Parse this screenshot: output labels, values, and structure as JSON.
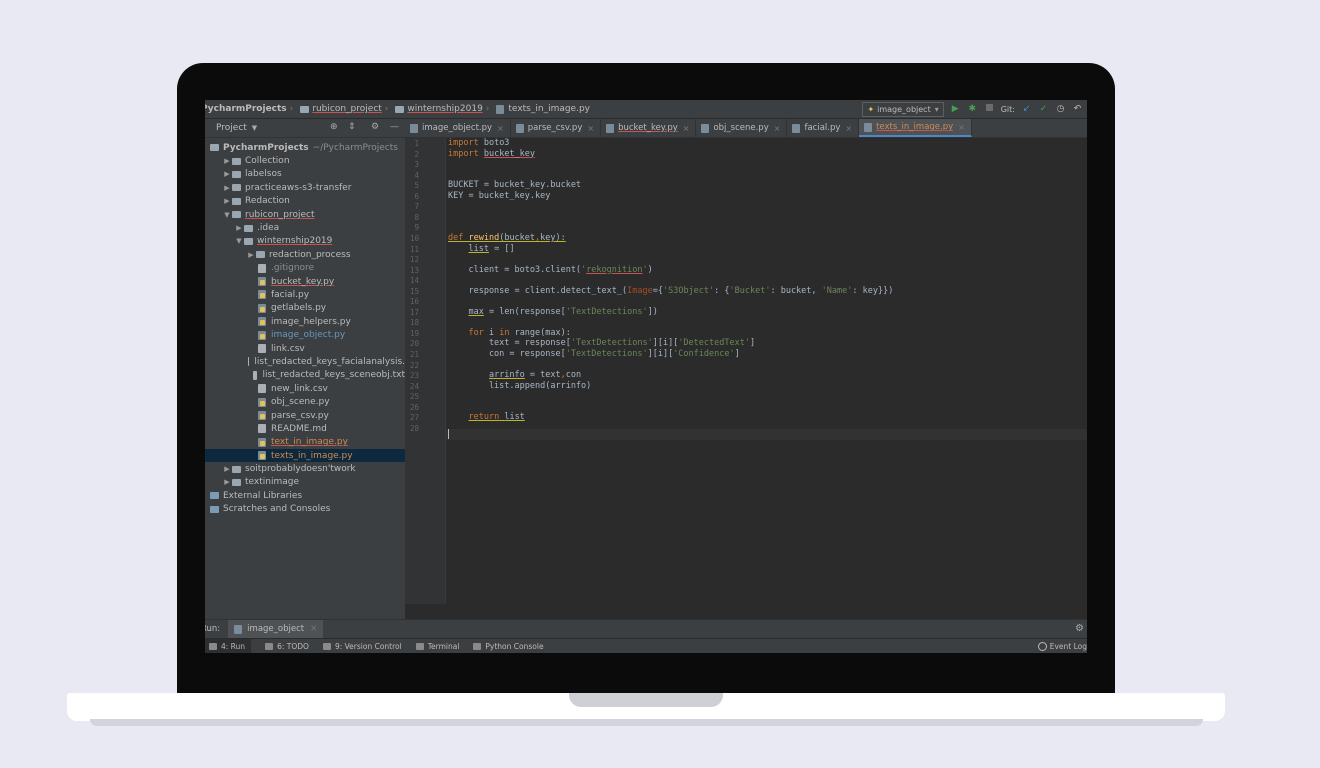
{
  "breadcrumbs": [
    "PycharmProjects",
    "rubicon_project",
    "winternship2019",
    "texts_in_image.py"
  ],
  "run_config": {
    "label": "image_object"
  },
  "git_label": "Git:",
  "project_pane": {
    "title": "Project",
    "root": {
      "name": "PycharmProjects",
      "path": "~/PycharmProjects"
    },
    "items": [
      {
        "label": "Collection",
        "type": "folder",
        "depth": 1,
        "arrow": "▶"
      },
      {
        "label": "labelsos",
        "type": "folder",
        "depth": 1,
        "arrow": "▶"
      },
      {
        "label": "practiceaws-s3-transfer",
        "type": "folder",
        "depth": 1,
        "arrow": "▶"
      },
      {
        "label": "Redaction",
        "type": "folder",
        "depth": 1,
        "arrow": "▶"
      },
      {
        "label": "rubicon_project",
        "type": "folder",
        "depth": 1,
        "arrow": "▼",
        "error": true
      },
      {
        "label": ".idea",
        "type": "folder",
        "depth": 2,
        "arrow": "▶"
      },
      {
        "label": "winternship2019",
        "type": "folder",
        "depth": 2,
        "arrow": "▼",
        "error": true
      },
      {
        "label": "redaction_process",
        "type": "folder",
        "depth": 3,
        "arrow": "▶"
      },
      {
        "label": ".gitignore",
        "type": "text",
        "depth": 3,
        "color": "grey"
      },
      {
        "label": "bucket_key.py",
        "type": "py",
        "depth": 3,
        "error": true
      },
      {
        "label": "facial.py",
        "type": "py",
        "depth": 3
      },
      {
        "label": "getlabels.py",
        "type": "py",
        "depth": 3
      },
      {
        "label": "image_helpers.py",
        "type": "py",
        "depth": 3
      },
      {
        "label": "image_object.py",
        "type": "py",
        "depth": 3,
        "color": "blue"
      },
      {
        "label": "link.csv",
        "type": "text",
        "depth": 3
      },
      {
        "label": "list_redacted_keys_facialanalysis.",
        "type": "text",
        "depth": 3
      },
      {
        "label": "list_redacted_keys_sceneobj.txt",
        "type": "text",
        "depth": 3
      },
      {
        "label": "new_link.csv",
        "type": "text",
        "depth": 3
      },
      {
        "label": "obj_scene.py",
        "type": "py",
        "depth": 3
      },
      {
        "label": "parse_csv.py",
        "type": "py",
        "depth": 3
      },
      {
        "label": "README.md",
        "type": "text",
        "depth": 3
      },
      {
        "label": "text_in_image.py",
        "type": "py",
        "depth": 3,
        "color": "orange",
        "error": true
      },
      {
        "label": "texts_in_image.py",
        "type": "py",
        "depth": 3,
        "color": "orange",
        "selected": true
      },
      {
        "label": "soitprobablydoesn'twork",
        "type": "folder",
        "depth": 1,
        "arrow": "▶"
      },
      {
        "label": "textinimage",
        "type": "folder",
        "depth": 1,
        "arrow": "▶"
      },
      {
        "label": "External Libraries",
        "type": "lib",
        "depth": 0
      },
      {
        "label": "Scratches and Consoles",
        "type": "lib",
        "depth": 0
      }
    ]
  },
  "tabs": [
    {
      "label": "image_object.py"
    },
    {
      "label": "parse_csv.py"
    },
    {
      "label": "bucket_key.py",
      "error": true
    },
    {
      "label": "obj_scene.py"
    },
    {
      "label": "facial.py"
    },
    {
      "label": "texts_in_image.py",
      "active": true
    }
  ],
  "code": {
    "line_numbers": [
      "1",
      "2",
      "3",
      "4",
      "5",
      "6",
      "7",
      "8",
      "9",
      "10",
      "11",
      "12",
      "13",
      "14",
      "15",
      "16",
      "17",
      "18",
      "19",
      "20",
      "21",
      "22",
      "23",
      "24",
      "25",
      "26",
      "27",
      "28"
    ],
    "lines": [
      [
        {
          "t": "import",
          "c": "kw"
        },
        {
          "t": " boto3"
        }
      ],
      [
        {
          "t": "import",
          "c": "kw"
        },
        {
          "t": " "
        },
        {
          "t": "bucket_key",
          "c": "und-r"
        }
      ],
      [],
      [],
      [
        {
          "t": "BUCKET = bucket_key.bucket"
        }
      ],
      [
        {
          "t": "KEY = bucket_key.key"
        }
      ],
      [],
      [],
      [],
      [
        {
          "t": "def",
          "c": "kw und-y"
        },
        {
          "t": " ",
          "c": "und-y"
        },
        {
          "t": "rewind",
          "c": "fn und-y"
        },
        {
          "t": "(bucket",
          "c": "und-y"
        },
        {
          "t": ",",
          "c": "kw und-y"
        },
        {
          "t": "key):",
          "c": "und-y"
        }
      ],
      [
        {
          "t": "    "
        },
        {
          "t": "list",
          "c": "und-y"
        },
        {
          "t": " = []"
        }
      ],
      [],
      [
        {
          "t": "    client = boto3.client("
        },
        {
          "t": "'",
          "c": "str"
        },
        {
          "t": "rekognition",
          "c": "str und-r"
        },
        {
          "t": "'",
          "c": "str"
        },
        {
          "t": ")"
        }
      ],
      [],
      [
        {
          "t": "    response = client.detect_text_("
        },
        {
          "t": "Image",
          "c": "param"
        },
        {
          "t": "={"
        },
        {
          "t": "'S3Object'",
          "c": "str"
        },
        {
          "t": ": {"
        },
        {
          "t": "'Bucket'",
          "c": "str"
        },
        {
          "t": ": bucket, "
        },
        {
          "t": "'Name'",
          "c": "str"
        },
        {
          "t": ": key}})"
        }
      ],
      [],
      [
        {
          "t": "    "
        },
        {
          "t": "max",
          "c": "und-y"
        },
        {
          "t": " = len(response["
        },
        {
          "t": "'TextDetections'",
          "c": "str"
        },
        {
          "t": "])"
        }
      ],
      [],
      [
        {
          "t": "    "
        },
        {
          "t": "for",
          "c": "kw"
        },
        {
          "t": " i "
        },
        {
          "t": "in",
          "c": "kw"
        },
        {
          "t": " range(max):"
        }
      ],
      [
        {
          "t": "        text = response["
        },
        {
          "t": "'TextDetections'",
          "c": "str"
        },
        {
          "t": "][i]["
        },
        {
          "t": "'DetectedText'",
          "c": "str"
        },
        {
          "t": "]"
        }
      ],
      [
        {
          "t": "        con = response["
        },
        {
          "t": "'TextDetections'",
          "c": "str"
        },
        {
          "t": "][i]["
        },
        {
          "t": "'Confidence'",
          "c": "str"
        },
        {
          "t": "]"
        }
      ],
      [],
      [
        {
          "t": "        "
        },
        {
          "t": "arrinfo",
          "c": "und-y"
        },
        {
          "t": " = text"
        },
        {
          "t": ",",
          "c": "kw"
        },
        {
          "t": "con"
        }
      ],
      [
        {
          "t": "        list.append(arrinfo)"
        }
      ],
      [],
      [],
      [
        {
          "t": "    "
        },
        {
          "t": "return",
          "c": "kw und-y"
        },
        {
          "t": " ",
          "c": "und-y"
        },
        {
          "t": "list",
          "c": "und-y"
        }
      ],
      []
    ]
  },
  "run_bar": {
    "label": "Run:",
    "tab": "image_object"
  },
  "tool_windows": [
    {
      "label": "4: Run",
      "active": true
    },
    {
      "label": "6: TODO"
    },
    {
      "label": "9: Version Control"
    },
    {
      "label": "Terminal"
    },
    {
      "label": "Python Console"
    }
  ],
  "event_log": "Event Log",
  "colors": {
    "keyword": "#cc7832",
    "string": "#6a8759",
    "function": "#ffc66d",
    "accent": "#4a88c7",
    "background": "#2b2b2b"
  }
}
